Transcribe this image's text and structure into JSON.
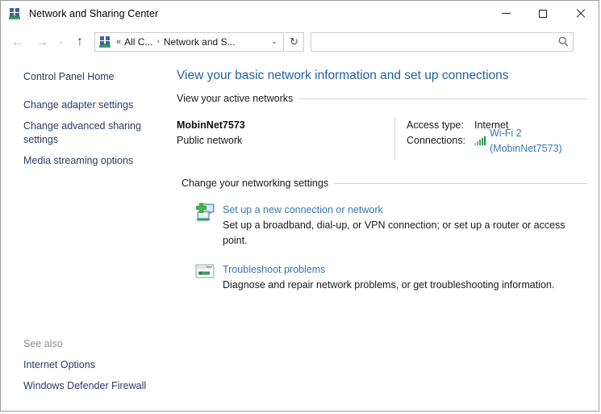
{
  "window": {
    "title": "Network and Sharing Center",
    "icon": "network-icon",
    "controls": {
      "minimize": "–",
      "maximize": "□",
      "close": "✕"
    }
  },
  "navbar": {
    "back": "←",
    "forward": "→",
    "recent": "⌄",
    "up": "↑",
    "breadcrumb": {
      "overflow": "«",
      "items": [
        "All C...",
        "Network and S..."
      ],
      "separator": "›",
      "dropdown": "⌄"
    },
    "refresh": "↻",
    "search": {
      "value": "",
      "placeholder": "",
      "icon": "⚲"
    }
  },
  "sidebar": {
    "primary_links": [
      "Control Panel Home",
      "Change adapter settings",
      "Change advanced sharing settings",
      "Media streaming options"
    ],
    "see_also_title": "See also",
    "see_also_links": [
      "Internet Options",
      "Windows Defender Firewall"
    ]
  },
  "content": {
    "page_title": "View your basic network information and set up connections",
    "active_networks_heading": "View your active networks",
    "active_network": {
      "name": "MobinNet7573",
      "type": "Public network",
      "access_type_label": "Access type:",
      "access_type_value": "Internet",
      "connections_label": "Connections:",
      "connections_value": "Wi-Fi 2 (MobinNet7573)",
      "signal_icon": "wifi-signal-icon"
    },
    "networking_settings_heading": "Change your networking settings",
    "tasks": [
      {
        "icon": "new-connection-icon",
        "link": "Set up a new connection or network",
        "description": "Set up a broadband, dial-up, or VPN connection; or set up a router or access point."
      },
      {
        "icon": "troubleshoot-icon",
        "link": "Troubleshoot problems",
        "description": "Diagnose and repair network problems, or get troubleshooting information."
      }
    ]
  },
  "colors": {
    "heading_blue": "#26619c",
    "link_blue": "#3a77b5",
    "sidebar_link": "#2b3a67",
    "signal_green": "#2f9e55"
  }
}
